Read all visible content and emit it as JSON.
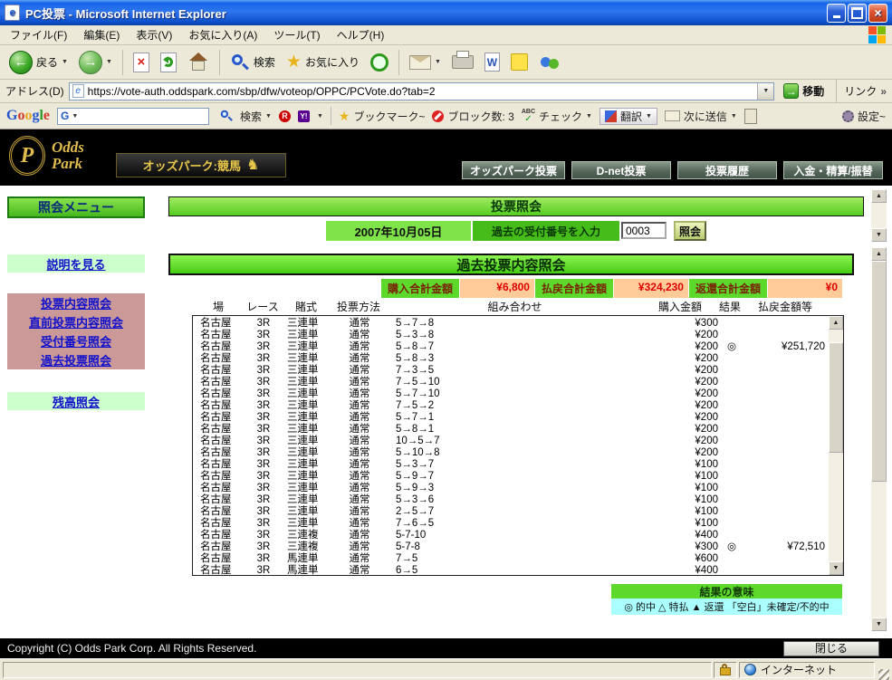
{
  "window": {
    "title": "PC投票 - Microsoft Internet Explorer"
  },
  "menubar": {
    "items": [
      {
        "label": "ファイル(F)"
      },
      {
        "label": "編集(E)"
      },
      {
        "label": "表示(V)"
      },
      {
        "label": "お気に入り(A)"
      },
      {
        "label": "ツール(T)"
      },
      {
        "label": "ヘルプ(H)"
      }
    ]
  },
  "toolbar": {
    "back_label": "戻る",
    "search_label": "検索",
    "favorites_label": "お気に入り"
  },
  "addressbar": {
    "label": "アドレス(D)",
    "url": "https://vote-auth.oddspark.com/sbp/dfw/voteop/OPPC/PCVote.do?tab=2",
    "go_label": "移動",
    "links_label": "リンク"
  },
  "googlebar": {
    "logo_letters": [
      "G",
      "o",
      "o",
      "g",
      "l",
      "e"
    ],
    "search_label": "検索",
    "bookmarks_label": "ブックマーク~",
    "block_label": "ブロック数: 3",
    "check_label": "チェック",
    "translate_label": "翻訳",
    "send_label": "次に送信",
    "settings_label": "設定~"
  },
  "site_header": {
    "logo_line1": "Odds",
    "logo_line2": "Park",
    "tagline": "オッズパーク:競馬",
    "nav": [
      {
        "label": "オッズパーク投票"
      },
      {
        "label": "D-net投票"
      },
      {
        "label": "投票履歴"
      },
      {
        "label": "入金・精算/振替"
      }
    ]
  },
  "sidebar": {
    "title": "照会メニュー",
    "help_link": "説明を見る",
    "links": [
      {
        "label": "投票内容照会"
      },
      {
        "label": "直前投票内容照会"
      },
      {
        "label": "受付番号照会"
      },
      {
        "label": "過去投票照会"
      }
    ],
    "balance_link": "残高照会"
  },
  "inquiry": {
    "title": "投票照会",
    "date": "2007年10月05日",
    "input_label": "過去の受付番号を入力",
    "input_value": "0003",
    "submit_label": "照会"
  },
  "results": {
    "title": "過去投票内容照会",
    "summary": [
      {
        "label": "購入合計金額",
        "value": "¥6,800"
      },
      {
        "label": "払戻合計金額",
        "value": "¥324,230"
      },
      {
        "label": "返還合計金額",
        "value": "¥0"
      }
    ],
    "columns": [
      "場",
      "レース",
      "賭式",
      "投票方法",
      "組み合わせ",
      "購入金額",
      "結果",
      "払戻金額等"
    ],
    "rows": [
      {
        "venue": "名古屋",
        "race": "3R",
        "type": "三連単",
        "method": "通常",
        "combo": "5→7→8",
        "amount": "¥300",
        "result": "",
        "payout": ""
      },
      {
        "venue": "名古屋",
        "race": "3R",
        "type": "三連単",
        "method": "通常",
        "combo": "5→3→8",
        "amount": "¥200",
        "result": "",
        "payout": ""
      },
      {
        "venue": "名古屋",
        "race": "3R",
        "type": "三連単",
        "method": "通常",
        "combo": "5→8→7",
        "amount": "¥200",
        "result": "◎",
        "payout": "¥251,720"
      },
      {
        "venue": "名古屋",
        "race": "3R",
        "type": "三連単",
        "method": "通常",
        "combo": "5→8→3",
        "amount": "¥200",
        "result": "",
        "payout": ""
      },
      {
        "venue": "名古屋",
        "race": "3R",
        "type": "三連単",
        "method": "通常",
        "combo": "7→3→5",
        "amount": "¥200",
        "result": "",
        "payout": ""
      },
      {
        "venue": "名古屋",
        "race": "3R",
        "type": "三連単",
        "method": "通常",
        "combo": "7→5→10",
        "amount": "¥200",
        "result": "",
        "payout": ""
      },
      {
        "venue": "名古屋",
        "race": "3R",
        "type": "三連単",
        "method": "通常",
        "combo": "5→7→10",
        "amount": "¥200",
        "result": "",
        "payout": ""
      },
      {
        "venue": "名古屋",
        "race": "3R",
        "type": "三連単",
        "method": "通常",
        "combo": "7→5→2",
        "amount": "¥200",
        "result": "",
        "payout": ""
      },
      {
        "venue": "名古屋",
        "race": "3R",
        "type": "三連単",
        "method": "通常",
        "combo": "5→7→1",
        "amount": "¥200",
        "result": "",
        "payout": ""
      },
      {
        "venue": "名古屋",
        "race": "3R",
        "type": "三連単",
        "method": "通常",
        "combo": "5→8→1",
        "amount": "¥200",
        "result": "",
        "payout": ""
      },
      {
        "venue": "名古屋",
        "race": "3R",
        "type": "三連単",
        "method": "通常",
        "combo": "10→5→7",
        "amount": "¥200",
        "result": "",
        "payout": ""
      },
      {
        "venue": "名古屋",
        "race": "3R",
        "type": "三連単",
        "method": "通常",
        "combo": "5→10→8",
        "amount": "¥200",
        "result": "",
        "payout": ""
      },
      {
        "venue": "名古屋",
        "race": "3R",
        "type": "三連単",
        "method": "通常",
        "combo": "5→3→7",
        "amount": "¥100",
        "result": "",
        "payout": ""
      },
      {
        "venue": "名古屋",
        "race": "3R",
        "type": "三連単",
        "method": "通常",
        "combo": "5→9→7",
        "amount": "¥100",
        "result": "",
        "payout": ""
      },
      {
        "venue": "名古屋",
        "race": "3R",
        "type": "三連単",
        "method": "通常",
        "combo": "5→9→3",
        "amount": "¥100",
        "result": "",
        "payout": ""
      },
      {
        "venue": "名古屋",
        "race": "3R",
        "type": "三連単",
        "method": "通常",
        "combo": "5→3→6",
        "amount": "¥100",
        "result": "",
        "payout": ""
      },
      {
        "venue": "名古屋",
        "race": "3R",
        "type": "三連単",
        "method": "通常",
        "combo": "2→5→7",
        "amount": "¥100",
        "result": "",
        "payout": ""
      },
      {
        "venue": "名古屋",
        "race": "3R",
        "type": "三連単",
        "method": "通常",
        "combo": "7→6→5",
        "amount": "¥100",
        "result": "",
        "payout": ""
      },
      {
        "venue": "名古屋",
        "race": "3R",
        "type": "三連複",
        "method": "通常",
        "combo": "5-7-10",
        "amount": "¥400",
        "result": "",
        "payout": ""
      },
      {
        "venue": "名古屋",
        "race": "3R",
        "type": "三連複",
        "method": "通常",
        "combo": "5-7-8",
        "amount": "¥300",
        "result": "◎",
        "payout": "¥72,510"
      },
      {
        "venue": "名古屋",
        "race": "3R",
        "type": "馬連単",
        "method": "通常",
        "combo": "7→5",
        "amount": "¥600",
        "result": "",
        "payout": ""
      },
      {
        "venue": "名古屋",
        "race": "3R",
        "type": "馬連単",
        "method": "通常",
        "combo": "6→5",
        "amount": "¥400",
        "result": "",
        "payout": ""
      }
    ],
    "legend_title": "結果の意味",
    "legend_text": "◎ 的中 △ 特払 ▲ 返還 「空白」未確定/不的中"
  },
  "footer": {
    "copyright": "Copyright (C) Odds Park Corp. All Rights Reserved.",
    "close_label": "閉じる"
  },
  "statusbar": {
    "zone": "インターネット"
  },
  "colors": {
    "title_bar_blue": "#1665e8",
    "chrome_tan": "#ECE9D8",
    "header_black": "#000000",
    "brand_gold": "#e0bc50",
    "bar_green": "#55cc22",
    "pale_green": "#ccffcc",
    "dusty_pink": "#cc9999",
    "value_peach": "#ffcc99",
    "value_red": "#e00000",
    "legend_cyan": "#aaffff",
    "link_blue": "#1111cc"
  }
}
